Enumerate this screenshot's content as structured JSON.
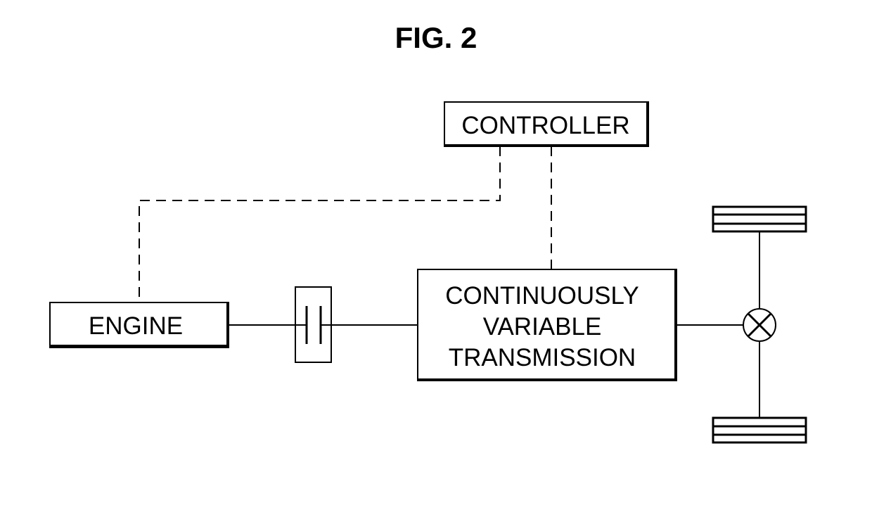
{
  "figure": {
    "title": "FIG. 2"
  },
  "blocks": {
    "controller": {
      "label": "CONTROLLER"
    },
    "engine": {
      "label": "ENGINE"
    },
    "cvt": {
      "lines": [
        "CONTINUOUSLY",
        "VARIABLE",
        "TRANSMISSION"
      ]
    },
    "clutch": {
      "symbol": "clutch-icon"
    },
    "differential": {
      "symbol": "differential-icon"
    },
    "wheels": {
      "symbol": "wheel-icon",
      "count": 2
    }
  },
  "connections": [
    {
      "from": "controller",
      "to": "engine",
      "style": "dashed",
      "kind": "control-signal"
    },
    {
      "from": "controller",
      "to": "cvt",
      "style": "dashed",
      "kind": "control-signal"
    },
    {
      "from": "engine",
      "to": "clutch",
      "style": "solid",
      "kind": "shaft"
    },
    {
      "from": "clutch",
      "to": "cvt",
      "style": "solid",
      "kind": "shaft"
    },
    {
      "from": "cvt",
      "to": "differential",
      "style": "solid",
      "kind": "shaft"
    },
    {
      "from": "differential",
      "to": "wheel-top",
      "style": "solid",
      "kind": "axle"
    },
    {
      "from": "differential",
      "to": "wheel-bottom",
      "style": "solid",
      "kind": "axle"
    }
  ],
  "colors": {
    "line": "#000000",
    "background": "#ffffff"
  }
}
